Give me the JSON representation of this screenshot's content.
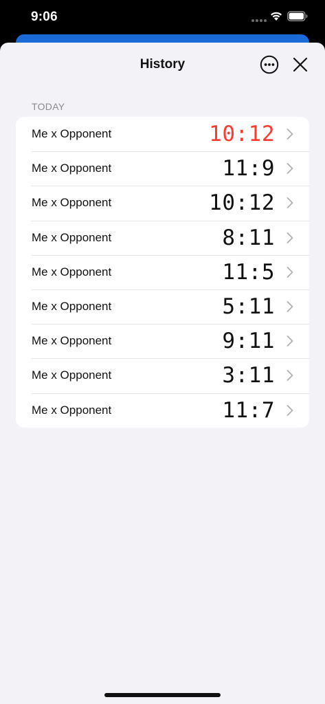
{
  "status_bar": {
    "time": "9:06",
    "icons": [
      "signal-dots-icon",
      "wifi-icon",
      "battery-icon"
    ]
  },
  "header": {
    "title": "History",
    "more_icon": "ellipsis-circle-icon",
    "close_icon": "close-x-icon"
  },
  "section": {
    "title": "TODAY"
  },
  "matches": [
    {
      "label": "Me x Opponent",
      "score": "10:12",
      "loss": true
    },
    {
      "label": "Me x Opponent",
      "score": "11:9",
      "loss": false
    },
    {
      "label": "Me x Opponent",
      "score": "10:12",
      "loss": false
    },
    {
      "label": "Me x Opponent",
      "score": "8:11",
      "loss": false
    },
    {
      "label": "Me x Opponent",
      "score": "11:5",
      "loss": false
    },
    {
      "label": "Me x Opponent",
      "score": "5:11",
      "loss": false
    },
    {
      "label": "Me x Opponent",
      "score": "9:11",
      "loss": false
    },
    {
      "label": "Me x Opponent",
      "score": "3:11",
      "loss": false
    },
    {
      "label": "Me x Opponent",
      "score": "11:7",
      "loss": false
    }
  ],
  "colors": {
    "loss_score": "#ff3b30",
    "accent_blue": "#1a6ad8",
    "sheet_background": "#f2f2f7"
  }
}
